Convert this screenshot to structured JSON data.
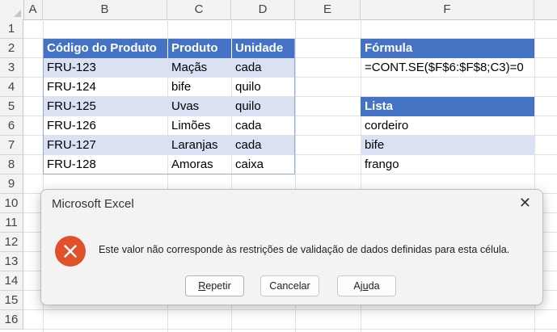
{
  "columns": [
    "A",
    "B",
    "C",
    "D",
    "E",
    "F"
  ],
  "rows": [
    "1",
    "2",
    "3",
    "4",
    "5",
    "6",
    "7",
    "8",
    "9",
    "10",
    "11",
    "12",
    "13",
    "14",
    "15",
    "16"
  ],
  "table": {
    "headers": [
      "Código do Produto",
      "Produto",
      "Unidade"
    ],
    "rows": [
      [
        "FRU-123",
        "Maçãs",
        "cada"
      ],
      [
        "FRU-124",
        "bife",
        "quilo"
      ],
      [
        "FRU-125",
        "Uvas",
        "quilo"
      ],
      [
        "FRU-126",
        "Limões",
        "cada"
      ],
      [
        "FRU-127",
        "Laranjas",
        "cada"
      ],
      [
        "FRU-128",
        "Amoras",
        "caixa"
      ]
    ]
  },
  "formula": {
    "header": "Fórmula",
    "value": "=CONT.SE($F$6:$F$8;C3)=0"
  },
  "list": {
    "header": "Lista",
    "items": [
      "cordeiro",
      "bife",
      "frango"
    ]
  },
  "colors": {
    "header_fill": "#4472c4",
    "band_fill": "#d9e1f2",
    "error_icon": "#e0502a"
  },
  "dialog": {
    "title": "Microsoft Excel",
    "close_label": "✕",
    "message": "Este valor não corresponde às restrições de validação de dados definidas para esta célula.",
    "icon": "error-circle-icon",
    "buttons": {
      "retry_pre": "",
      "retry_key": "R",
      "retry_post": "epetir",
      "cancel": "Cancelar",
      "help_pre": "Aj",
      "help_key": "u",
      "help_post": "da"
    }
  }
}
